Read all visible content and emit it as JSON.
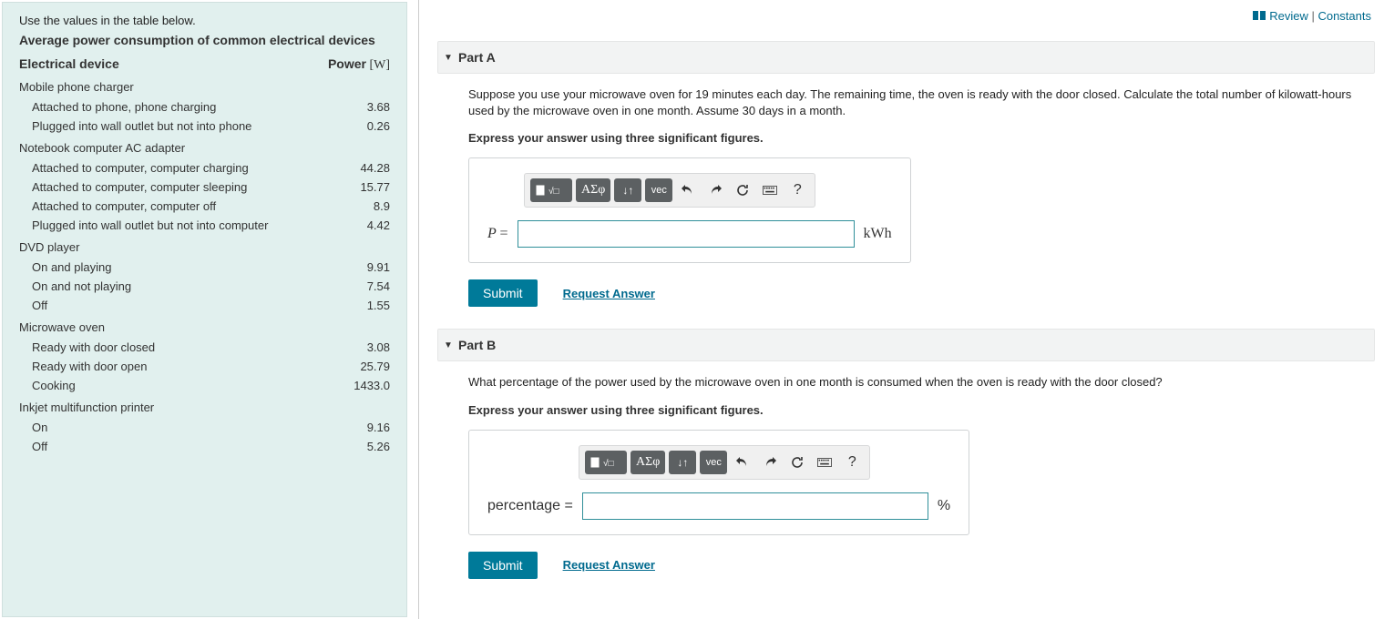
{
  "topLinks": {
    "review": "Review",
    "constants": "Constants"
  },
  "table": {
    "intro": "Use the values in the table below.",
    "title": "Average power consumption of common electrical devices",
    "col_device": "Electrical device",
    "col_power_label": "Power",
    "col_power_unit": "[W]",
    "sections": [
      {
        "head": "Mobile phone charger",
        "rows": [
          {
            "label": "Attached to phone, phone charging",
            "val": "3.68"
          },
          {
            "label": "Plugged into wall outlet but not into phone",
            "val": "0.26"
          }
        ]
      },
      {
        "head": "Notebook computer AC adapter",
        "rows": [
          {
            "label": "Attached to computer, computer charging",
            "val": "44.28"
          },
          {
            "label": "Attached to computer, computer sleeping",
            "val": "15.77"
          },
          {
            "label": "Attached to computer, computer off",
            "val": "8.9"
          },
          {
            "label": "Plugged into wall outlet but not into computer",
            "val": "4.42"
          }
        ]
      },
      {
        "head": "DVD player",
        "rows": [
          {
            "label": "On and playing",
            "val": "9.91"
          },
          {
            "label": "On and not playing",
            "val": "7.54"
          },
          {
            "label": "Off",
            "val": "1.55"
          }
        ]
      },
      {
        "head": "Microwave oven",
        "rows": [
          {
            "label": "Ready with door closed",
            "val": "3.08"
          },
          {
            "label": "Ready with door open",
            "val": "25.79"
          },
          {
            "label": "Cooking",
            "val": "1433.0"
          }
        ]
      },
      {
        "head": "Inkjet multifunction printer",
        "rows": [
          {
            "label": "On",
            "val": "9.16"
          },
          {
            "label": "Off",
            "val": "5.26"
          }
        ]
      }
    ]
  },
  "toolbar": {
    "greek": "ΑΣφ",
    "sortarrow": "↓↑",
    "vec": "vec",
    "help": "?"
  },
  "partA": {
    "title": "Part A",
    "prompt": "Suppose you use your microwave oven for 19 minutes each day. The remaining time, the oven is ready with the door closed. Calculate the total number of kilowatt-hours used by the microwave oven in one month. Assume 30 days in a month.",
    "hint": "Express your answer using three significant figures.",
    "var": "P",
    "eq": "=",
    "unit": "kWh",
    "submit": "Submit",
    "request": "Request Answer"
  },
  "partB": {
    "title": "Part B",
    "prompt": "What percentage of the power used by the microwave oven in one month is consumed when the oven is ready with the door closed?",
    "hint": "Express your answer using three significant figures.",
    "var": "percentage",
    "eq": "=",
    "unit": "%",
    "submit": "Submit",
    "request": "Request Answer"
  }
}
